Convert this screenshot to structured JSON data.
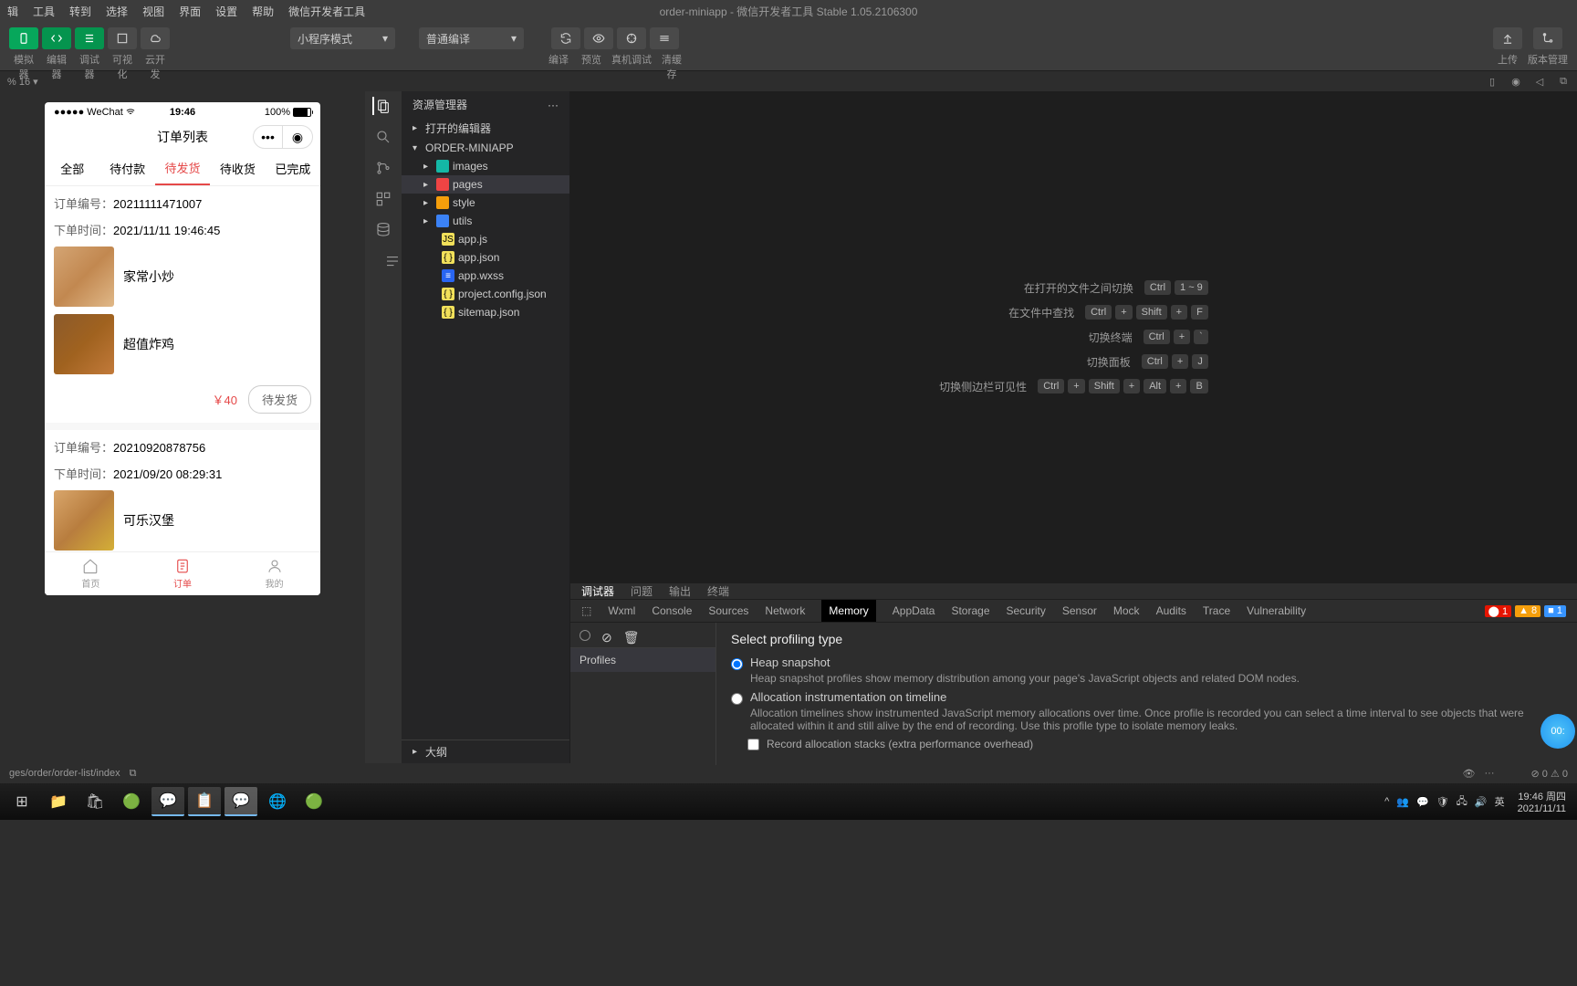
{
  "menubar": {
    "items": [
      "辑",
      "工具",
      "转到",
      "选择",
      "视图",
      "界面",
      "设置",
      "帮助",
      "微信开发者工具"
    ],
    "title": "order-miniapp - 微信开发者工具 Stable 1.05.2106300"
  },
  "toolbar": {
    "left": {
      "labels": [
        "模拟器",
        "编辑器",
        "调试器",
        "可视化",
        "云开发"
      ]
    },
    "dropdown1": "小程序模式",
    "dropdown2": "普通编译",
    "center": {
      "labels": [
        "编译",
        "预览",
        "真机调试",
        "清缓存"
      ]
    },
    "right": {
      "labels": [
        "上传",
        "版本管理"
      ]
    }
  },
  "zoom": {
    "label": "% 16 ▾"
  },
  "simulator": {
    "statusbar": {
      "carrier": "●●●●● WeChat",
      "time": "19:46",
      "battery": "100%"
    },
    "navbar": {
      "title": "订单列表"
    },
    "tabs": [
      "全部",
      "待付款",
      "待发货",
      "待收货",
      "已完成"
    ],
    "activeTab": 2,
    "orders": [
      {
        "orderNoLabel": "订单编号：",
        "orderNo": "20211111471007",
        "timeLabel": "下单时间：",
        "time": "2021/11/11 19:46:45",
        "items": [
          {
            "name": "家常小炒",
            "img": "food1"
          },
          {
            "name": "超值炸鸡",
            "img": "food2"
          }
        ],
        "price": "￥40",
        "status": "待发货"
      },
      {
        "orderNoLabel": "订单编号：",
        "orderNo": "20210920878756",
        "timeLabel": "下单时间：",
        "time": "2021/09/20 08:29:31",
        "items": [
          {
            "name": "可乐汉堡",
            "img": "food3"
          }
        ]
      }
    ],
    "tabbar": [
      {
        "label": "首页"
      },
      {
        "label": "订单"
      },
      {
        "label": "我的"
      }
    ],
    "tabbarActive": 1
  },
  "explorer": {
    "title": "资源管理器",
    "nodes": [
      {
        "label": "打开的编辑器",
        "level": 1,
        "arrow": "▸"
      },
      {
        "label": "ORDER-MINIAPP",
        "level": 1,
        "arrow": "▾",
        "bold": true
      },
      {
        "label": "images",
        "level": 2,
        "arrow": "▸",
        "icon": "folderteal"
      },
      {
        "label": "pages",
        "level": 2,
        "arrow": "▸",
        "icon": "folderred",
        "sel": true
      },
      {
        "label": "style",
        "level": 2,
        "arrow": "▸",
        "icon": "folderorange"
      },
      {
        "label": "utils",
        "level": 2,
        "arrow": "▸",
        "icon": "folderblue"
      },
      {
        "label": "app.js",
        "level": 3,
        "icon": "js",
        "iconText": "JS"
      },
      {
        "label": "app.json",
        "level": 3,
        "icon": "json",
        "iconText": "{ }"
      },
      {
        "label": "app.wxss",
        "level": 3,
        "icon": "wxss",
        "iconText": "≡"
      },
      {
        "label": "project.config.json",
        "level": 3,
        "icon": "json",
        "iconText": "{ }"
      },
      {
        "label": "sitemap.json",
        "level": 3,
        "icon": "json",
        "iconText": "{ }"
      }
    ],
    "outline": "大纲"
  },
  "shortcuts": [
    {
      "label": "在打开的文件之间切换",
      "keys": [
        "Ctrl",
        "1 ~ 9"
      ]
    },
    {
      "label": "在文件中查找",
      "keys": [
        "Ctrl",
        "+",
        "Shift",
        "+",
        "F"
      ]
    },
    {
      "label": "切换终端",
      "keys": [
        "Ctrl",
        "+",
        "`"
      ]
    },
    {
      "label": "切换面板",
      "keys": [
        "Ctrl",
        "+",
        "J"
      ]
    },
    {
      "label": "切换侧边栏可见性",
      "keys": [
        "Ctrl",
        "+",
        "Shift",
        "+",
        "Alt",
        "+",
        "B"
      ]
    }
  ],
  "devtools": {
    "primaryTabs": [
      "调试器",
      "问题",
      "输出",
      "终端"
    ],
    "primaryActive": 0,
    "tabs": [
      "Wxml",
      "Console",
      "Sources",
      "Network",
      "Memory",
      "AppData",
      "Storage",
      "Security",
      "Sensor",
      "Mock",
      "Audits",
      "Trace",
      "Vulnerability"
    ],
    "activeTab": 4,
    "badges": {
      "err": "1",
      "warn": "8",
      "info": "1"
    },
    "profiles": "Profiles",
    "title": "Select profiling type",
    "options": [
      {
        "label": "Heap snapshot",
        "desc": "Heap snapshot profiles show memory distribution among your page's JavaScript objects and related DOM nodes.",
        "checked": true
      },
      {
        "label": "Allocation instrumentation on timeline",
        "desc": "Allocation timelines show instrumented JavaScript memory allocations over time. Once profile is recorded you can select a time interval to see objects that were allocated within it and still alive by the end of recording. Use this profile type to isolate memory leaks."
      }
    ],
    "checkbox": "Record allocation stacks (extra performance overhead)"
  },
  "statusbar": {
    "path": "ges/order/order-list/index",
    "errors": "⊘ 0 ⚠ 0"
  },
  "taskbar": {
    "clock": {
      "time": "19:46 周四",
      "date": "2021/11/11"
    },
    "ime": "英"
  },
  "floatbtn": "00:"
}
